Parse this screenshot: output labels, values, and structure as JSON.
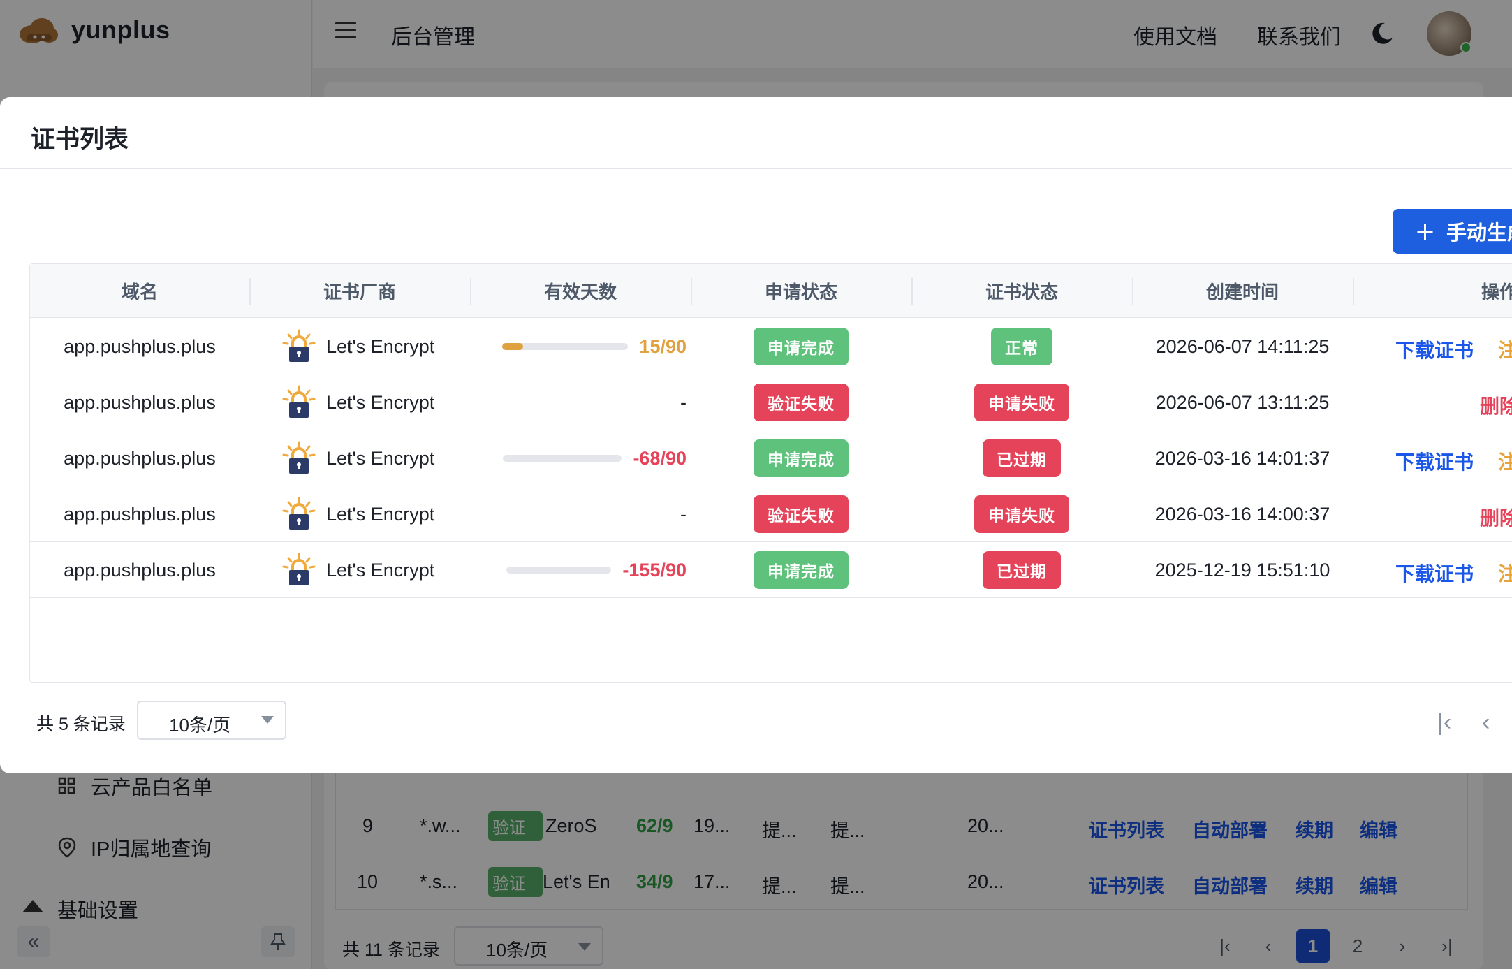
{
  "app": {
    "brand": "yunplus",
    "header": {
      "title": "后台管理",
      "docs": "使用文档",
      "contact": "联系我们"
    },
    "sidebar": {
      "items": [
        {
          "label": "云产品白名单",
          "icon": "grid-icon"
        },
        {
          "label": "IP归属地查询",
          "icon": "location-pin-icon"
        }
      ],
      "group": "基础设置"
    }
  },
  "background_table": {
    "rows": [
      {
        "index": "9",
        "domain": "*.w...",
        "tag": "验证",
        "vendor": "ZeroS",
        "days": "62/9",
        "c5": "19...",
        "c6": "提...",
        "c7": "提...",
        "c8": "20...",
        "actions": [
          "证书列表",
          "自动部署",
          "续期",
          "编辑"
        ]
      },
      {
        "index": "10",
        "domain": "*.s...",
        "tag": "验证",
        "vendor": "Let's En",
        "days": "34/9",
        "c5": "17...",
        "c6": "提...",
        "c7": "提...",
        "c8": "20...",
        "actions": [
          "证书列表",
          "自动部署",
          "续期",
          "编辑"
        ]
      }
    ],
    "footer": {
      "total": "共 11 条记录",
      "page_size": "10条/页",
      "pages": [
        "1",
        "2"
      ],
      "current_page": "1"
    }
  },
  "modal": {
    "title": "证书列表",
    "generate_button": "手动生成",
    "columns": [
      "域名",
      "证书厂商",
      "有效天数",
      "申请状态",
      "证书状态",
      "创建时间",
      "操作"
    ],
    "rows": [
      {
        "domain": "app.pushplus.plus",
        "vendor": "Let's Encrypt",
        "days": "15/90",
        "progress": 0.1667,
        "days_color": "#e0a141",
        "apply_status": "申请完成",
        "apply_color": "green",
        "cert_status": "正常",
        "cert_color": "green",
        "created": "2026-06-07 14:11:25",
        "op_primary": "下载证书",
        "op_secondary": "注"
      },
      {
        "domain": "app.pushplus.plus",
        "vendor": "Let's Encrypt",
        "days": "-",
        "progress": null,
        "days_color": "#1d2129",
        "apply_status": "验证失败",
        "apply_color": "red",
        "cert_status": "申请失败",
        "cert_color": "red",
        "created": "2026-06-07 13:11:25",
        "op_primary": "",
        "op_secondary": "删除"
      },
      {
        "domain": "app.pushplus.plus",
        "vendor": "Let's Encrypt",
        "days": "-68/90",
        "progress": 0,
        "days_color": "#e5435a",
        "apply_status": "申请完成",
        "apply_color": "green",
        "cert_status": "已过期",
        "cert_color": "red",
        "created": "2026-03-16 14:01:37",
        "op_primary": "下载证书",
        "op_secondary": "注"
      },
      {
        "domain": "app.pushplus.plus",
        "vendor": "Let's Encrypt",
        "days": "-",
        "progress": null,
        "days_color": "#1d2129",
        "apply_status": "验证失败",
        "apply_color": "red",
        "cert_status": "申请失败",
        "cert_color": "red",
        "created": "2026-03-16 14:00:37",
        "op_primary": "",
        "op_secondary": "删除"
      },
      {
        "domain": "app.pushplus.plus",
        "vendor": "Let's Encrypt",
        "days": "-155/90",
        "progress": 0,
        "days_color": "#e5435a",
        "apply_status": "申请完成",
        "apply_color": "green",
        "cert_status": "已过期",
        "cert_color": "red",
        "created": "2025-12-19 15:51:10",
        "op_primary": "下载证书",
        "op_secondary": "注"
      }
    ],
    "footer": {
      "total": "共 5 条记录",
      "page_size": "10条/页"
    }
  },
  "colors": {
    "primary": "#1e5fe0",
    "success": "#5fc27c",
    "danger": "#e5435a",
    "warning": "#e0a141"
  }
}
